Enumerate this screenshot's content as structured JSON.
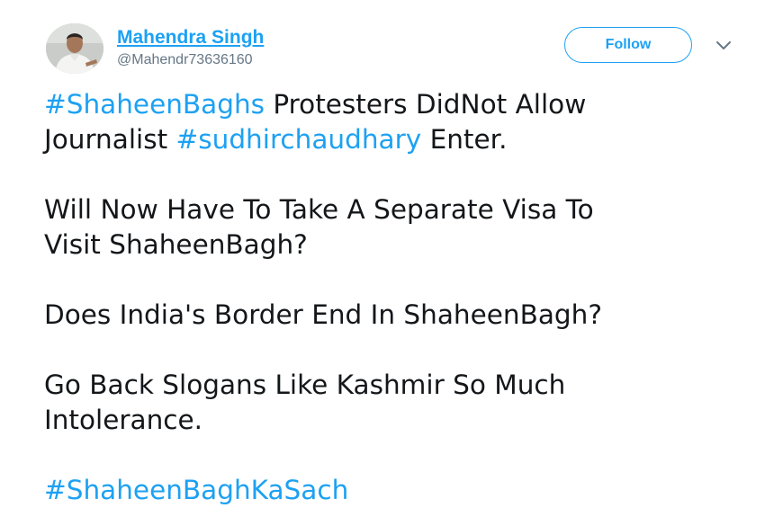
{
  "author": {
    "display_name": "Mahendra Singh",
    "handle": "@Mahendr73636160",
    "avatar_icon": "profile-photo"
  },
  "actions": {
    "follow_label": "Follow",
    "more_icon": "chevron-down-icon"
  },
  "tweet": {
    "p1": {
      "hashtag1": "#ShaheenBaghs",
      "text1": " Protesters DidNot Allow",
      "text2": "Journalist ",
      "hashtag2": "#sudhirchaudhary",
      "text3": " Enter."
    },
    "p2": {
      "line1": "Will Now Have To Take A Separate Visa To",
      "line2": "Visit ShaheenBagh?"
    },
    "p3": {
      "line1": "Does India's Border End In ShaheenBagh?"
    },
    "p4": {
      "line1": "Go Back Slogans Like Kashmir So Much",
      "line2": "Intolerance."
    },
    "p5": {
      "hashtag": "#ShaheenBaghKaSach"
    }
  },
  "colors": {
    "accent": "#1da1f2",
    "text": "#14171a",
    "secondary": "#657786"
  }
}
